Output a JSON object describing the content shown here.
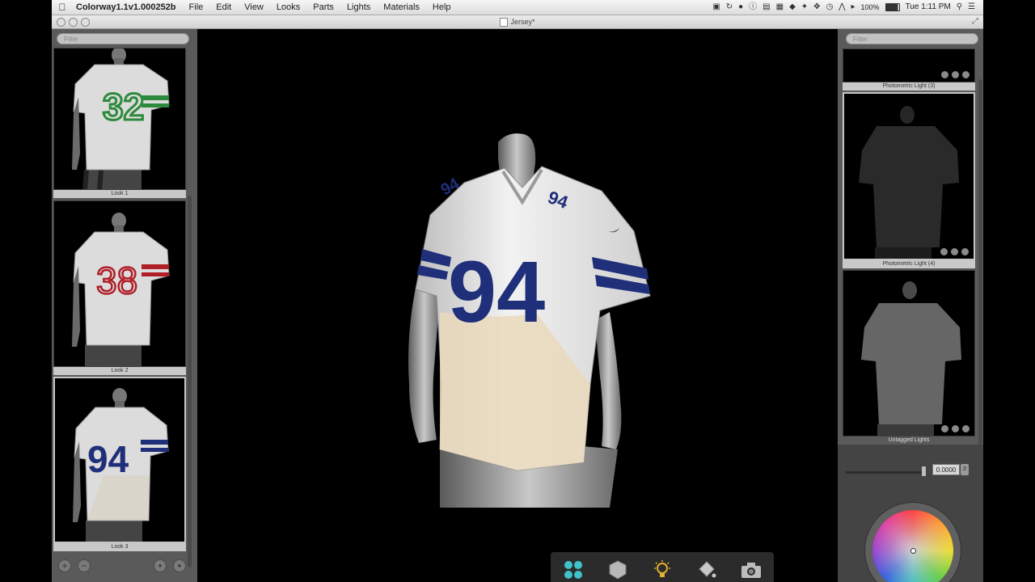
{
  "menubar": {
    "app_name": "Colorway1.1v1.000252b",
    "menus": [
      "File",
      "Edit",
      "View",
      "Looks",
      "Parts",
      "Lights",
      "Materials",
      "Help"
    ],
    "battery": "100%",
    "clock": "Tue 1:11 PM"
  },
  "window": {
    "title": "Jersey*"
  },
  "left_panel": {
    "filter_placeholder": "Filter",
    "looks": [
      {
        "caption": "Look 1",
        "number": "32",
        "number_color": "#2d8a3c",
        "stripe_color": "#2d8a3c"
      },
      {
        "caption": "Look 2",
        "number": "38",
        "number_color": "#b01e28",
        "stripe_color": "#b01e28"
      },
      {
        "caption": "Look 3",
        "number": "94",
        "number_color": "#1f2f7a",
        "stripe_color": "#1f2f7a"
      }
    ]
  },
  "viewport": {
    "jersey_number": "94",
    "number_color": "#1f2f7a",
    "body_color": "#e8e8e8",
    "accent_color": "#ead8bc",
    "toolbar": [
      "looks-grid-icon",
      "parts-shield-icon",
      "lights-bulb-icon",
      "materials-paint-icon",
      "camera-icon"
    ]
  },
  "right_panel": {
    "filter_placeholder": "Filter",
    "lights": [
      {
        "caption": "Photometric Light (3)"
      },
      {
        "caption": "Photometric Light (4)"
      },
      {
        "caption": "Untagged Lights"
      }
    ],
    "color": {
      "slider_value": "0.0000"
    }
  }
}
